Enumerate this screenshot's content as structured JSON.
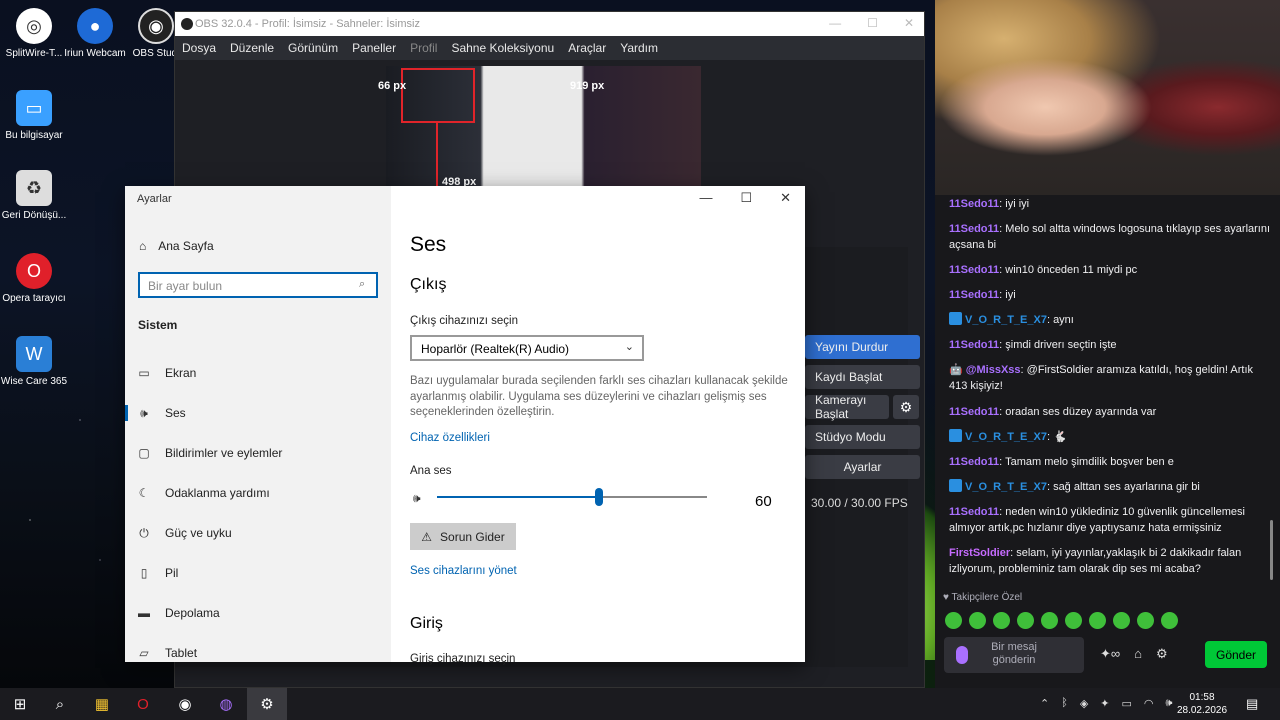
{
  "desktop": {
    "icons": [
      {
        "label": "SplitWire-T...",
        "icon": "globe-shield-icon",
        "color": "#ffffff"
      },
      {
        "label": "Iriun Webcam",
        "icon": "webcam-icon",
        "color": "#1e6ad6"
      },
      {
        "label": "OBS Studi",
        "icon": "obs-icon",
        "color": "#333333"
      },
      {
        "label": "Bu bilgisayar",
        "icon": "computer-icon",
        "color": "#3aa0ff"
      },
      {
        "label": "Geri Dönüşü...",
        "icon": "recycle-bin-icon",
        "color": "#dddddd"
      },
      {
        "label": "Opera tarayıcı",
        "icon": "opera-icon",
        "color": "#e0202a"
      },
      {
        "label": "Wise Care 365",
        "icon": "wise-care-icon",
        "color": "#2a7fd6"
      }
    ]
  },
  "obs": {
    "title": "OBS 32.0.4 - Profil: İsimsiz - Sahneler: İsimsiz",
    "menu": [
      "Dosya",
      "Düzenle",
      "Görünüm",
      "Paneller",
      "Profil",
      "Sahne Koleksiyonu",
      "Araçlar",
      "Yardım"
    ],
    "preview_labels": {
      "left": "66 px",
      "right": "919 px",
      "bottom": "498 px"
    },
    "controls": [
      "Yayını Durdur",
      "Kaydı Başlat",
      "Kamerayı Başlat",
      "Stüdyo Modu",
      "Ayarlar"
    ],
    "fps": "30.00 / 30.00 FPS"
  },
  "settings": {
    "window_title": "Ayarlar",
    "home": "Ana Sayfa",
    "search_placeholder": "Bir ayar bulun",
    "section": "Sistem",
    "nav": [
      {
        "label": "Ekran",
        "icon": "display-icon"
      },
      {
        "label": "Ses",
        "icon": "speaker-icon",
        "selected": true
      },
      {
        "label": "Bildirimler ve eylemler",
        "icon": "notifications-icon"
      },
      {
        "label": "Odaklanma yardımı",
        "icon": "moon-icon"
      },
      {
        "label": "Güç ve uyku",
        "icon": "power-icon"
      },
      {
        "label": "Pil",
        "icon": "battery-icon"
      },
      {
        "label": "Depolama",
        "icon": "storage-icon"
      },
      {
        "label": "Tablet",
        "icon": "tablet-icon"
      }
    ],
    "page_title": "Ses",
    "output_heading": "Çıkış",
    "output_select_label": "Çıkış cihazınızı seçin",
    "output_device": "Hoparlör (Realtek(R) Audio)",
    "description": "Bazı uygulamalar burada seçilenden farklı ses cihazları kullanacak şekilde ayarlanmış olabilir. Uygulama ses düzeylerini ve cihazları gelişmiş ses seçeneklerinden özelleştirin.",
    "device_props_link": "Cihaz özellikleri",
    "master_volume_label": "Ana ses",
    "volume": 60,
    "volume_text": "60",
    "troubleshoot": "Sorun Gider",
    "manage_devices_link": "Ses cihazlarını yönet",
    "input_heading": "Giriş",
    "input_select_label": "Giriş cihazınızı seçin"
  },
  "chat": {
    "messages": [
      {
        "user": "11Sedo11",
        "text": "iyi iyi",
        "color": "#a970ff"
      },
      {
        "user": "11Sedo11",
        "text": "Melo sol altta windows logosuna tıklayıp ses ayarlarını açsana bi",
        "color": "#a970ff"
      },
      {
        "user": "11Sedo11",
        "text": "win10 önceden 11 miydi pc",
        "color": "#a970ff"
      },
      {
        "user": "11Sedo11",
        "text": "iyi",
        "color": "#a970ff"
      },
      {
        "user": "V_O_R_T_E_X7",
        "text": "aynı",
        "color": "#2a8fe0",
        "badge": true
      },
      {
        "user": "11Sedo11",
        "text": "şimdi driverı seçtin işte",
        "color": "#a970ff"
      },
      {
        "user": "@MissXss",
        "text": "@FirstSoldier aramıza katıldı, hoş geldin! Artık 413 kişiyiz!",
        "color": "#a970ff",
        "bot": true
      },
      {
        "user": "11Sedo11",
        "text": "oradan ses düzey ayarında var",
        "color": "#a970ff"
      },
      {
        "user": "V_O_R_T_E_X7",
        "text": "",
        "color": "#2a8fe0",
        "badge": true
      },
      {
        "user": "11Sedo11",
        "text": "Tamam melo şimdilik boşver ben e",
        "color": "#a970ff"
      },
      {
        "user": "V_O_R_T_E_X7",
        "text": "sağ alttan ses ayarlarına gir bi",
        "color": "#2a8fe0",
        "badge": true
      },
      {
        "user": "11Sedo11",
        "text": "neden win10 yüklediniz 10 güvenlik güncellemesi almıyor artık,pc hızlanır diye yaptıysanız hata ermişsiniz",
        "color": "#a970ff"
      },
      {
        "user": "FirstSoldier",
        "text": "selam, iyi yayınlar,yaklaşık bi 2 dakikadır falan izliyorum, probleminiz tam olarak dip ses mi acaba?",
        "color": "#c66bff"
      }
    ],
    "followers_only": "Takipçilere Özel",
    "input_placeholder": "Bir mesaj gönderin",
    "send": "Gönder"
  },
  "taskbar": {
    "time": "01:58",
    "date": "28.02.2026"
  }
}
